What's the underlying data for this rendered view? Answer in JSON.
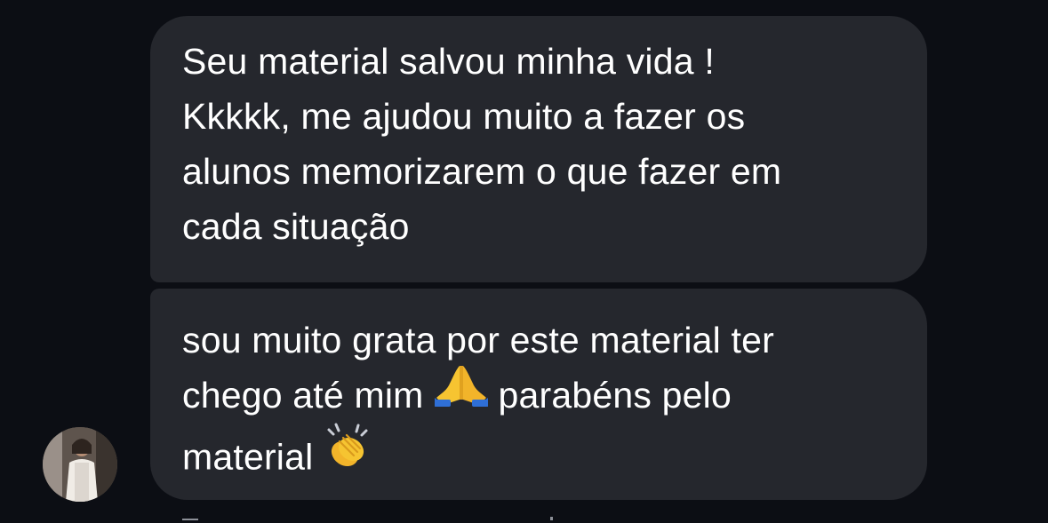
{
  "conversation": {
    "messages": [
      {
        "lines": [
          "Seu material salvou minha vida !",
          "Kkkkk, me ajudou muito a fazer os",
          "alunos memorizarem o que fazer em",
          "cada situação"
        ]
      },
      {
        "line1": "sou muito grata por este material ter",
        "line2_a": "chego até mim",
        "line2_emoji": "folded-hands-emoji",
        "line2_b": "parabéns pelo",
        "line3_a": "material",
        "line3_emoji": "clapping-hands-emoji"
      }
    ]
  },
  "avatar": {
    "icon": "profile-photo"
  },
  "colors": {
    "background": "#0c0e14",
    "bubble": "#25272d",
    "text": "#ffffff",
    "emoji_yellow": "#f6c431",
    "emoji_blue": "#2f6fd6"
  }
}
